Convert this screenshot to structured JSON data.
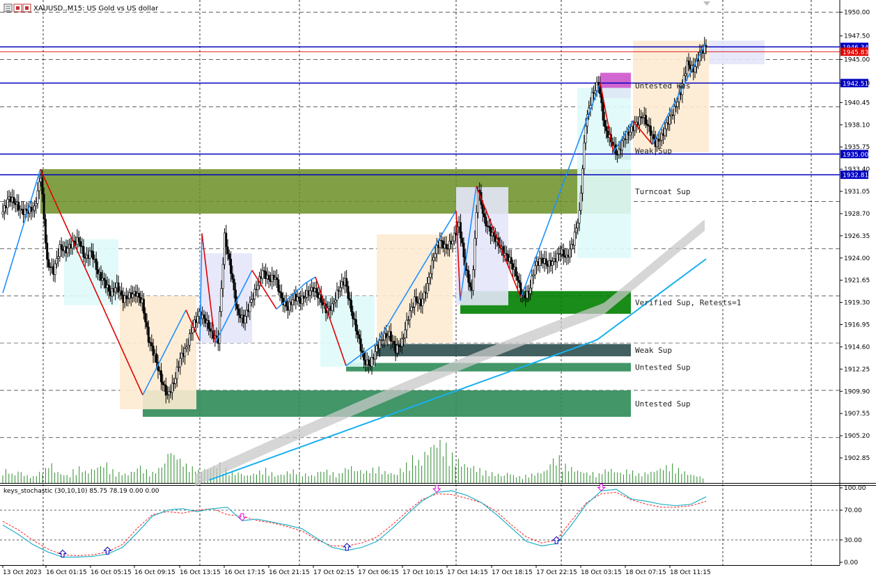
{
  "window": {
    "title": "XAUUSD.,M15: US Gold vs US dollar"
  },
  "chart_data": {
    "type": "candlestick",
    "symbol": "XAUUSD.",
    "timeframe": "M15",
    "description": "US Gold vs US dollar",
    "ylim": [
      1900.2,
      1951.3
    ],
    "price_ticks": [
      1950.0,
      1947.5,
      1945.0,
      1942.5,
      1940.45,
      1938.1,
      1935.75,
      1933.4,
      1931.05,
      1928.7,
      1926.35,
      1924.0,
      1921.65,
      1919.3,
      1916.95,
      1914.6,
      1912.25,
      1909.9,
      1907.55,
      1905.2,
      1902.85
    ],
    "round_levels": [
      1950.0,
      1945.0,
      1940.0,
      1935.0,
      1930.0,
      1925.0,
      1920.0,
      1915.0,
      1910.0,
      1905.0
    ],
    "time_labels": [
      "13 Oct 2023",
      "16 Oct 01:15",
      "16 Oct 05:15",
      "16 Oct 09:15",
      "16 Oct 13:15",
      "16 Oct 17:15",
      "16 Oct 21:15",
      "17 Oct 02:15",
      "17 Oct 06:15",
      "17 Oct 10:15",
      "17 Oct 14:15",
      "17 Oct 18:15",
      "17 Oct 22:15",
      "18 Oct 03:15",
      "18 Oct 07:15",
      "18 Oct 11:15"
    ],
    "horizontal_lines": [
      {
        "price": 1946.34,
        "color": "#0000c0",
        "label": "1946.34"
      },
      {
        "price": 1942.51,
        "color": "#0000c0",
        "label": "1942.51"
      },
      {
        "price": 1935.0,
        "color": "#0000c0",
        "label": "1935.00"
      },
      {
        "price": 1932.81,
        "color": "#0000c0",
        "label": "1932.81"
      },
      {
        "price": 1945.83,
        "color": "#e00000",
        "label": "1945.83"
      }
    ],
    "zones": [
      {
        "label": "Untested Res",
        "top": 1943.6,
        "bottom": 1940.9,
        "color": "#cc55cc"
      },
      {
        "label": "Weak Sup",
        "top": 1936.3,
        "bottom": 1934.4,
        "color": "#2f4f4f"
      },
      {
        "label": "Turncoat Sup",
        "top": 1933.4,
        "bottom": 1928.7,
        "color": "#6b8e23"
      },
      {
        "label": "Verified Sup, Retests=1",
        "top": 1920.5,
        "bottom": 1918.1,
        "color": "#008000"
      },
      {
        "label": "Weak Sup",
        "top": 1914.9,
        "bottom": 1913.6,
        "color": "#2f4f4f"
      },
      {
        "label": "Untested Sup",
        "top": 1912.9,
        "bottom": 1912.0,
        "color": "#2e8b57"
      },
      {
        "label": "Untested Sup",
        "top": 1910.0,
        "bottom": 1907.2,
        "color": "#2e8b57"
      }
    ],
    "close_series": [
      1928.9,
      1930.4,
      1929.8,
      1928.9,
      1929.0,
      1929.2,
      1932.8,
      1923.5,
      1922.6,
      1925.1,
      1924.8,
      1925.6,
      1925.9,
      1923.9,
      1924.7,
      1922.4,
      1921.5,
      1920.2,
      1921.1,
      1919.6,
      1920.0,
      1920.3,
      1919.3,
      1915.4,
      1913.6,
      1911.1,
      1909.4,
      1910.8,
      1913.4,
      1914.5,
      1916.8,
      1918.1,
      1917.4,
      1916.0,
      1915.3,
      1926.3,
      1922.7,
      1918.3,
      1917.4,
      1919.1,
      1920.8,
      1922.6,
      1921.7,
      1922.0,
      1919.6,
      1918.7,
      1919.9,
      1919.5,
      1920.2,
      1920.8,
      1919.8,
      1918.5,
      1918.9,
      1920.7,
      1921.7,
      1918.4,
      1915.9,
      1913.1,
      1912.7,
      1914.5,
      1915.6,
      1915.9,
      1914.3,
      1915.1,
      1917.8,
      1919.6,
      1919.2,
      1921.1,
      1924.2,
      1925.8,
      1925.0,
      1925.9,
      1927.6,
      1923.0,
      1920.3,
      1931.5,
      1928.0,
      1926.7,
      1925.8,
      1924.6,
      1923.8,
      1922.3,
      1919.9,
      1920.3,
      1923.2,
      1923.9,
      1923.3,
      1923.7,
      1924.7,
      1924.0,
      1925.7,
      1928.7,
      1938.3,
      1941.2,
      1942.6,
      1937.7,
      1936.4,
      1934.9,
      1936.6,
      1937.4,
      1938.2,
      1939.1,
      1937.7,
      1936.1,
      1936.8,
      1938.5,
      1939.7,
      1941.6,
      1944.6,
      1943.9,
      1945.6,
      1946.4
    ]
  },
  "indicator": {
    "label": "keys_stochastic (30,10,10) 85.75 78.19 0.00 0.00",
    "ylim": [
      0,
      100
    ],
    "ticks": [
      "100.00",
      "70.00",
      "30.00",
      "0.00"
    ],
    "k_series": [
      50,
      38,
      24,
      14,
      7,
      7,
      8,
      11,
      20,
      40,
      62,
      70,
      72,
      68,
      72,
      74,
      56,
      58,
      54,
      50,
      45,
      32,
      20,
      16,
      20,
      28,
      45,
      64,
      82,
      94,
      96,
      90,
      80,
      64,
      46,
      28,
      22,
      25,
      50,
      78,
      96,
      98,
      85,
      82,
      78,
      76,
      78,
      88
    ],
    "d_series": [
      55,
      44,
      30,
      18,
      10,
      9,
      10,
      14,
      24,
      46,
      64,
      68,
      66,
      70,
      72,
      64,
      62,
      56,
      53,
      48,
      42,
      30,
      22,
      22,
      26,
      34,
      50,
      68,
      84,
      92,
      91,
      86,
      80,
      68,
      50,
      34,
      26,
      30,
      56,
      80,
      92,
      94,
      84,
      78,
      74,
      74,
      76,
      82
    ],
    "k_color": "#20b0c8",
    "d_color": "#ff2020"
  }
}
